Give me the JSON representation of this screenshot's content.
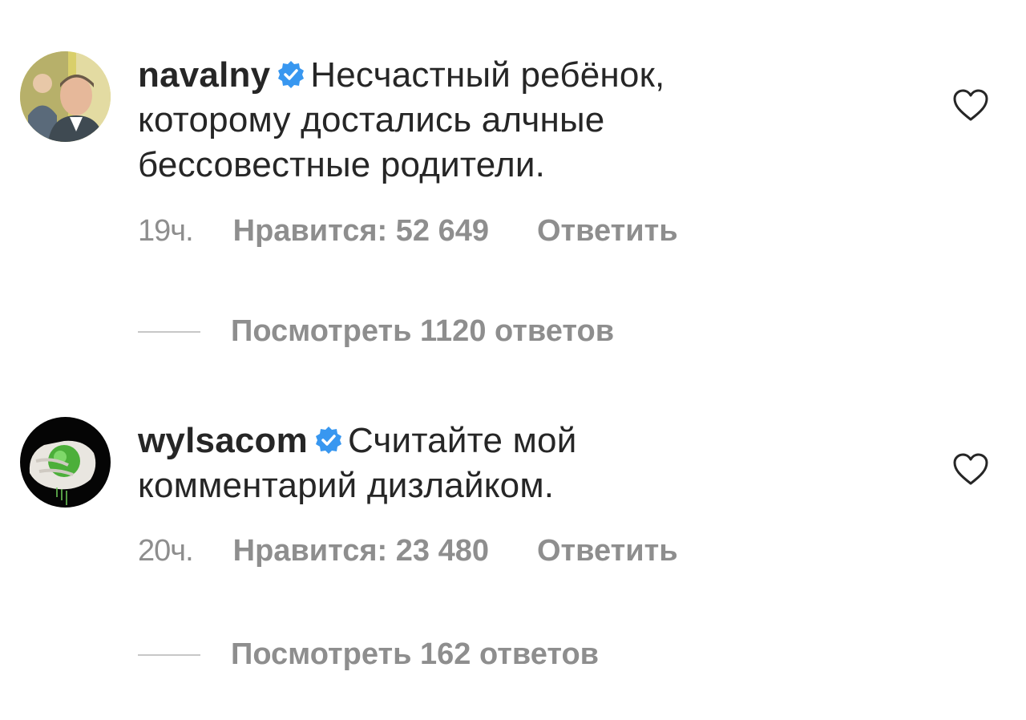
{
  "comments": [
    {
      "username": "navalny",
      "verified": true,
      "text": "Несчастный ребёнок, которому достались алчные бессовестные родители.",
      "time": "19ч.",
      "likes": "Нравится: 52 649",
      "reply": "Ответить",
      "view_replies": "Посмотреть 1120 ответов",
      "avatar_icon": "user-photo"
    },
    {
      "username": "wylsacom",
      "verified": true,
      "text": "Считайте мой комментарий дизлайком.",
      "time": "20ч.",
      "likes": "Нравится: 23 480",
      "reply": "Ответить",
      "view_replies": "Посмотреть 162 ответов",
      "avatar_icon": "hand-squeezing-apple"
    }
  ],
  "colors": {
    "text": "#262626",
    "meta": "#8e8e8e",
    "verified": "#3897f0",
    "divider": "#c7c7c7"
  },
  "icons": {
    "verified": "verified-badge-icon",
    "like": "heart-outline-icon"
  }
}
